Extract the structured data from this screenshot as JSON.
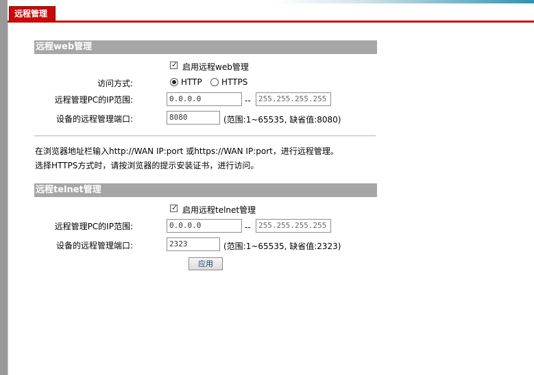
{
  "tab": {
    "label": "远程管理"
  },
  "web_section": {
    "title": "远程web管理",
    "enable_label": "启用远程web管理",
    "enabled": true,
    "access_mode_label": "访问方式:",
    "mode_http": "HTTP",
    "mode_https": "HTTPS",
    "selected_mode": "HTTP",
    "ip_range_label": "远程管理PC的IP范围:",
    "ip_start": "0.0.0.0",
    "range_sep": "--",
    "ip_end": "255.255.255.255",
    "port_label": "设备的远程管理端口:",
    "port_value": "8080",
    "port_hint": "(范围:1~65535, 缺省值:8080)",
    "note_line1": "在浏览器地址栏输入http://WAN IP:port 或https://WAN IP:port，进行远程管理。",
    "note_line2": "选择HTTPS方式时，请按浏览器的提示安装证书，进行访问。"
  },
  "telnet_section": {
    "title": "远程telnet管理",
    "enable_label": "启用远程telnet管理",
    "enabled": true,
    "ip_range_label": "远程管理PC的IP范围:",
    "ip_start": "0.0.0.0",
    "range_sep": "--",
    "ip_end": "255.255.255.255",
    "port_label": "设备的远程管理端口:",
    "port_value": "2323",
    "port_hint": "(范围:1~65535, 缺省值:2323)"
  },
  "apply_button": {
    "label": "应用"
  },
  "colors": {
    "tab_red": "#c80a0a",
    "section_gray": "#a6a6a6"
  }
}
